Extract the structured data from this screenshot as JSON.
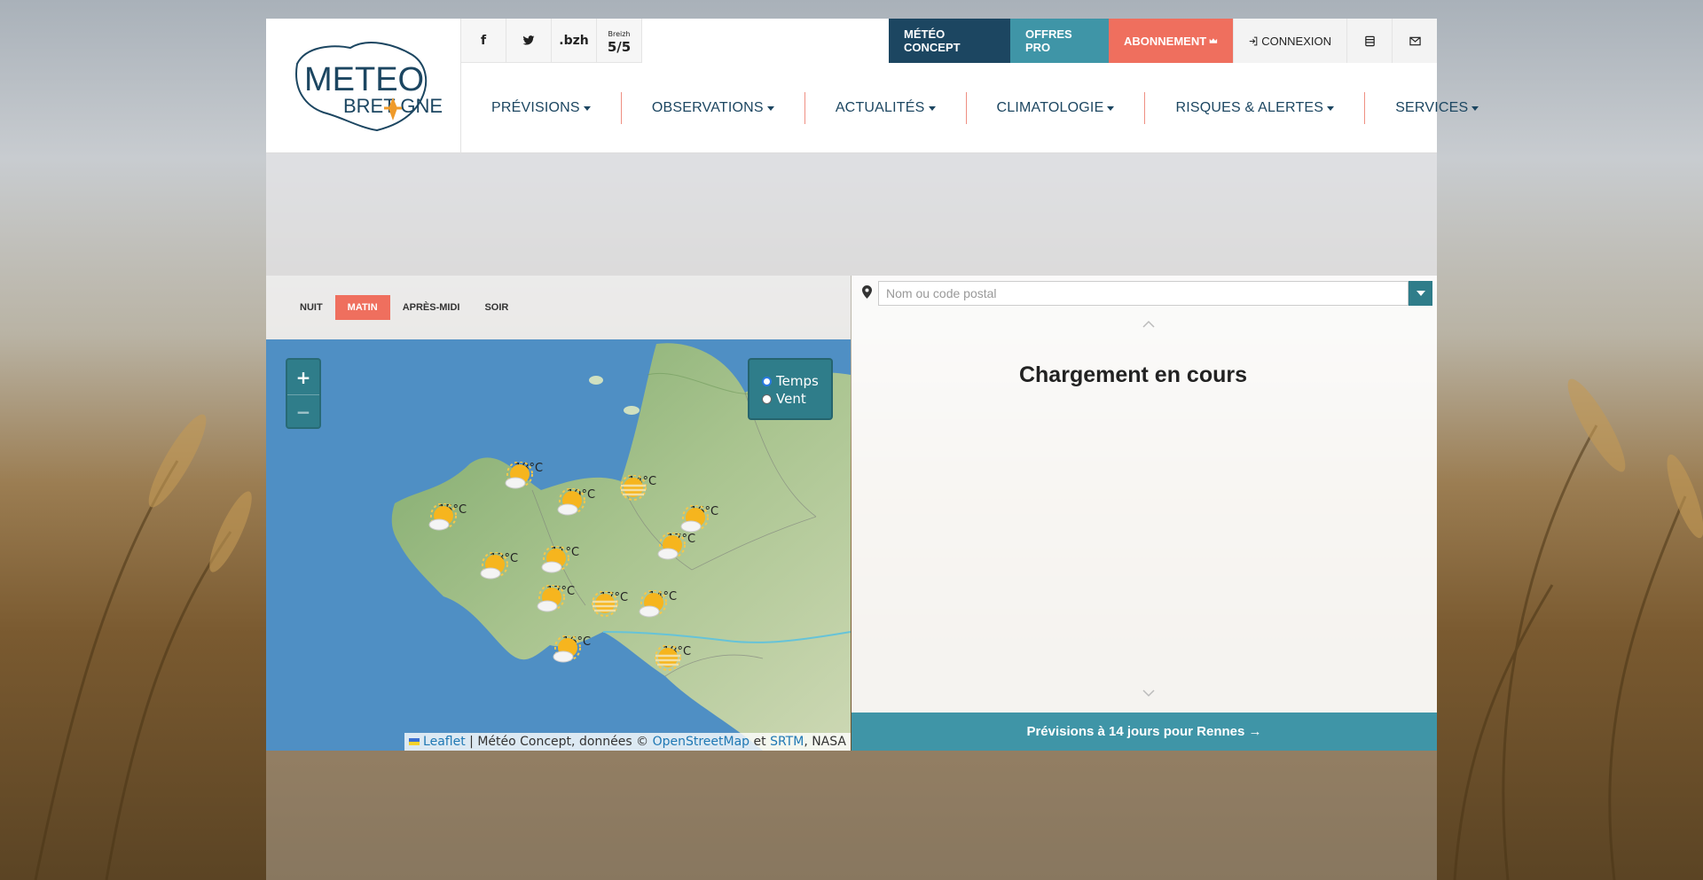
{
  "header": {
    "logo_text_top": "METEO",
    "logo_text_bottom": "BRET GNE",
    "social": [
      {
        "icon": "facebook-icon",
        "label": "f"
      },
      {
        "icon": "twitter-icon",
        "label": ""
      },
      {
        "icon": "bzh-icon",
        "label": ".bzh"
      },
      {
        "icon": "breizh-badge-icon",
        "label": "5/5",
        "sublabel": "Breizh"
      }
    ],
    "topbar": {
      "meteo_concept": "MÉTÉO CONCEPT",
      "offres_pro": "OFFRES PRO",
      "abonnement": "ABONNEMENT",
      "connexion": "CONNEXION"
    },
    "nav": [
      "PRÉVISIONS",
      "OBSERVATIONS",
      "ACTUALITÉS",
      "CLIMATOLOGIE",
      "RISQUES & ALERTES",
      "SERVICES"
    ]
  },
  "periods": {
    "items": [
      "NUIT",
      "MATIN",
      "APRÈS-MIDI",
      "SOIR"
    ],
    "active": "MATIN"
  },
  "map": {
    "zoom_in": "+",
    "zoom_out": "−",
    "layers": [
      "Temps",
      "Vent"
    ],
    "layer_selected": "Temps",
    "stations": [
      {
        "temp": "18°C",
        "icon": "sun-cloud-icon"
      },
      {
        "temp": "15°C",
        "icon": "sun-cloud-icon"
      },
      {
        "temp": "19°C",
        "icon": "sun-cloud-icon"
      },
      {
        "temp": "14°C",
        "icon": "sun-haze-icon"
      },
      {
        "temp": "16°C",
        "icon": "sun-cloud-icon"
      },
      {
        "temp": "17°C",
        "icon": "sun-cloud-icon"
      },
      {
        "temp": "11°C",
        "icon": "sun-cloud-icon"
      },
      {
        "temp": "13°C",
        "icon": "sun-cloud-icon"
      },
      {
        "temp": "17°C",
        "icon": "sun-cloud-icon"
      },
      {
        "temp": "17°C",
        "icon": "sun-haze-icon"
      },
      {
        "temp": "14°C",
        "icon": "sun-cloud-icon"
      },
      {
        "temp": "16°C",
        "icon": "sun-cloud-icon"
      },
      {
        "temp": "18°C",
        "icon": "sun-haze-icon"
      }
    ],
    "attribution": {
      "leaflet": "Leaflet",
      "text1": "| Météo Concept, données ©",
      "osm": "OpenStreetMap",
      "text2": "et",
      "srtm": "SRTM",
      "text3": ", NASA"
    }
  },
  "right_panel": {
    "search_placeholder": "Nom ou code postal",
    "loading": "Chargement en cours",
    "forecast_button": "Prévisions à 14 jours pour Rennes →"
  },
  "colors": {
    "navy": "#1c4661",
    "teal": "#3f95a7",
    "coral": "#ef6f5e"
  }
}
